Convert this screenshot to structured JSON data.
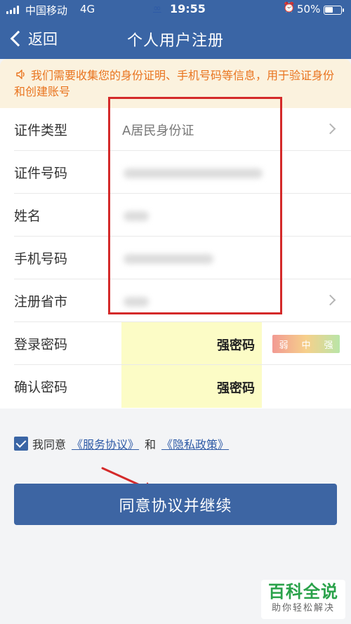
{
  "status_bar": {
    "carrier": "中国移动",
    "network": "4G",
    "time": "19:55",
    "battery": "50%",
    "icons": [
      "signal-icon",
      "link-icon",
      "alarm-icon",
      "battery-icon"
    ]
  },
  "nav": {
    "back_label": "返回",
    "title": "个人用户注册"
  },
  "notice": {
    "icon": "speaker-icon",
    "text": "我们需要收集您的身份证明、手机号码等信息，用于验证身份和创建账号"
  },
  "form": {
    "id_type": {
      "label": "证件类型",
      "value": "A居民身份证"
    },
    "id_number": {
      "label": "证件号码"
    },
    "name": {
      "label": "姓名"
    },
    "phone": {
      "label": "手机号码"
    },
    "province": {
      "label": "注册省市"
    },
    "login_password": {
      "label": "登录密码",
      "value": "强密码"
    },
    "confirm_password": {
      "label": "确认密码",
      "value": "强密码"
    },
    "strength": {
      "weak": "弱",
      "medium": "中",
      "strong": "强"
    }
  },
  "agreement": {
    "checked": true,
    "prefix": "我同意",
    "service_link": "《服务协议》",
    "and": "和",
    "privacy_link": "《隐私政策》"
  },
  "submit_button": "同意协议并继续",
  "watermark": {
    "title": "百科全说",
    "subtitle": "助你轻松解决"
  },
  "colors": {
    "primary": "#3a65a5",
    "notice_bg": "#fbf2de",
    "notice_text": "#e9741f",
    "highlight_field": "#fcfcc6",
    "annotation_red": "#d42a2a",
    "watermark_green": "#2aa24a"
  }
}
